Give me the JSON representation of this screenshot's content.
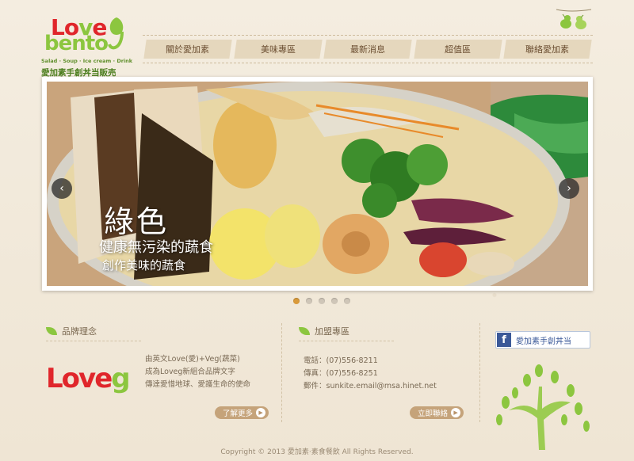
{
  "header": {
    "logo_word1_a": "Lo",
    "logo_word1_b": "v",
    "logo_word1_c": "e",
    "logo_word2": "bento",
    "logo_tagline": "Salad · Soup · Ice cream · Drink",
    "logo_subtitle": "愛加素手創丼当販売"
  },
  "nav": {
    "items": [
      "關於愛加素",
      "美味專區",
      "最新消息",
      "超值區",
      "聯絡愛加素"
    ]
  },
  "banner": {
    "title": "綠色",
    "subtitle1": "健康無污染的蔬食",
    "subtitle2": "創作美味的蔬食",
    "prev": "‹",
    "next": "›",
    "dots_total": 5,
    "dots_active": 1
  },
  "brand": {
    "heading": "品牌理念",
    "line1": "由英文Love(愛)+Veg(蔬菜)",
    "line2": "成為Loveg新組合品牌文字",
    "line3": "傳達愛惜地球、愛護生命的使命",
    "more_label": "了解更多",
    "logo_a": "Lo",
    "logo_b": "ve",
    "logo_c": "g"
  },
  "franchise": {
    "heading": "加盟專區",
    "phone": "電話：(07)556-8211",
    "fax": "傳真：(07)556-8251",
    "email": "郵件：sunkite.email@msa.hinet.net",
    "contact_label": "立即聯絡"
  },
  "social": {
    "fb_glyph": "f",
    "fb_label": "愛加素手創丼当"
  },
  "footer": {
    "copyright": "Copyright © 2013  愛加素‧素食餐飲 All Rights Reserved."
  },
  "colors": {
    "accent_green": "#8cc63f",
    "logo_red": "#e0262b",
    "button_tan": "#c5a37a",
    "active_dot": "#d99a3a"
  }
}
